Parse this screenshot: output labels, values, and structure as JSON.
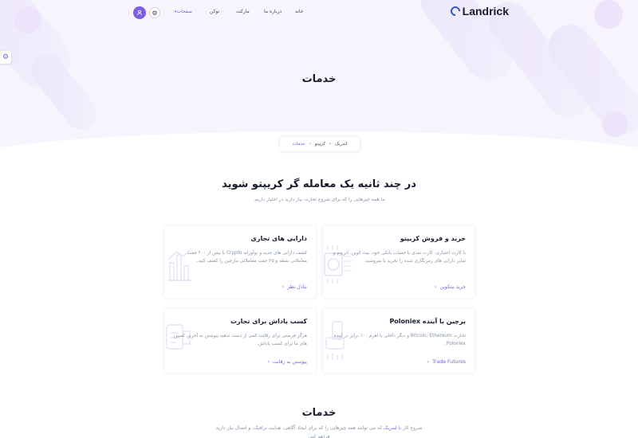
{
  "header": {
    "logo_text": "Landrick",
    "nav": {
      "home": "خانه",
      "about": "درباره ما",
      "market": "مارکت",
      "token": "توکن",
      "pages": "صفحات"
    }
  },
  "hero": {
    "title": "خدمات"
  },
  "breadcrumb": {
    "items": [
      "لندریک",
      "کریپتو",
      "خدمات"
    ]
  },
  "section": {
    "title": "در چند ثانیه یک معامله گر کریپتو شوید",
    "subtitle": "ما همه چیزهایی را که برای شروع تجارت نیاز دارید در اختیار داریم."
  },
  "cards": [
    {
      "title": "خرید و فروش کریپتو",
      "text": "با کارت اعتباری، کارت نقدی یا حساب بانکی خود، بیت کوین، اتریوم و سایر دارایی های رمزنگاری شده را بخرید یا بفروشید.",
      "link": "خرید بیتکوین",
      "icon": "bitcoin-chip-icon"
    },
    {
      "title": "دارایی های تجاری",
      "text": "کشف دارایی های جدید و نوآورانه Crypto با بیش از ۲۰۰ جفت معاملاتی نقطه و ۲۵ جفت معاملاتی مارجین را کشف کنید.",
      "link": "تبادل نظر",
      "icon": "chart-bars-icon"
    },
    {
      "title": "پرچین با آینده Poloniex",
      "text": "تجارت Bitcoin، Ethereum و دیگر داخلی با اهرم ۱۰۰ برابر در آینده Poloniex.",
      "link": "Trade Futures",
      "icon": "futures-icon"
    },
    {
      "title": "کسب پاداش برای تجارت",
      "text": "هرگز فرصتی برای رقابت کمی از دست ندهید پیوستن به آخرین کمپین های ما برای کسب پاداش.",
      "link": "پیوستن به رقابت",
      "icon": "reward-icon"
    }
  ],
  "bottom": {
    "title": "خدمات",
    "text_before": "شروع کار با ",
    "brand": "لندریک",
    "text_after": " که می توانند همه چیزهایی را که برای ایجاد آگاهی، هدایت ترافیک، و اتصال نیاز دارید فراهم کند."
  },
  "colors": {
    "primary": "#7a5fe0",
    "logo": "#2f55d4",
    "hero_bg": "#f7f4fd"
  }
}
